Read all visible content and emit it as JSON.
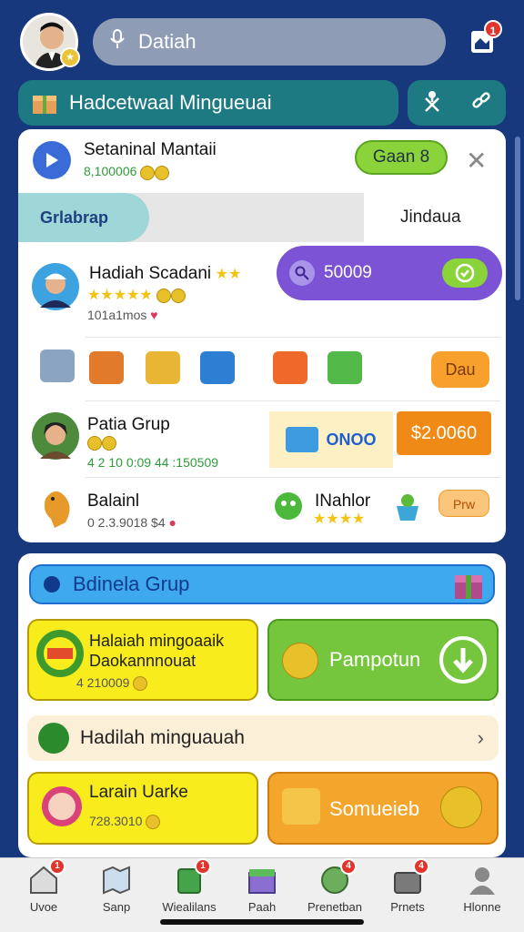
{
  "header": {
    "search_text": "Datiah",
    "inbox_badge": "1",
    "banner_title": "Hadcetwaal Mingueuai"
  },
  "card1": {
    "title": "Setaninal Mantaii",
    "subtitle": "8,100006",
    "go_button": "Gaan 8",
    "close_symbol": "✕",
    "tab_left": "Grlabrap",
    "tab_right": "Jindaua",
    "bubble_value": "50009",
    "row1": {
      "name": "Hadiah Scadani",
      "meta": "101a1mos"
    },
    "row2": {
      "button": "Dau"
    },
    "row3": {
      "name": "Patia Grup",
      "meta": "4 2 10 0:09 44 :150509",
      "center_label": "ONOO",
      "price": "$2.0060"
    },
    "row4": {
      "name": "Balainl",
      "meta": "0 2.3.9018 $4",
      "name2": "INahlor",
      "button": "Prw"
    }
  },
  "card2": {
    "group_bar": "Bdinela Grup",
    "tile1": {
      "title": "Halaiah mingoaaik",
      "sub": "Daokannnouat",
      "meta": "4 210009"
    },
    "tile2": {
      "title": "Pampotun"
    },
    "hadiah_row": "Hadilah minguauah",
    "tile3": {
      "title": "Larain Uarke",
      "meta": "728.3010"
    },
    "tile4": {
      "title": "Somueieb"
    }
  },
  "nav": {
    "items": [
      {
        "label": "Uvoe",
        "badge": "1"
      },
      {
        "label": "Sanp",
        "badge": ""
      },
      {
        "label": "Wiealilans",
        "badge": "1"
      },
      {
        "label": "Paah",
        "badge": ""
      },
      {
        "label": "Prenetban",
        "badge": "4"
      },
      {
        "label": "Prnets",
        "badge": "4"
      },
      {
        "label": "Hlonne",
        "badge": ""
      }
    ]
  },
  "colors": {
    "background": "#17387d",
    "accent_green": "#8bd33b",
    "accent_orange": "#f7a12c",
    "tile_yellow": "#f8ec1d",
    "bubble_purple": "#7b53d4"
  }
}
